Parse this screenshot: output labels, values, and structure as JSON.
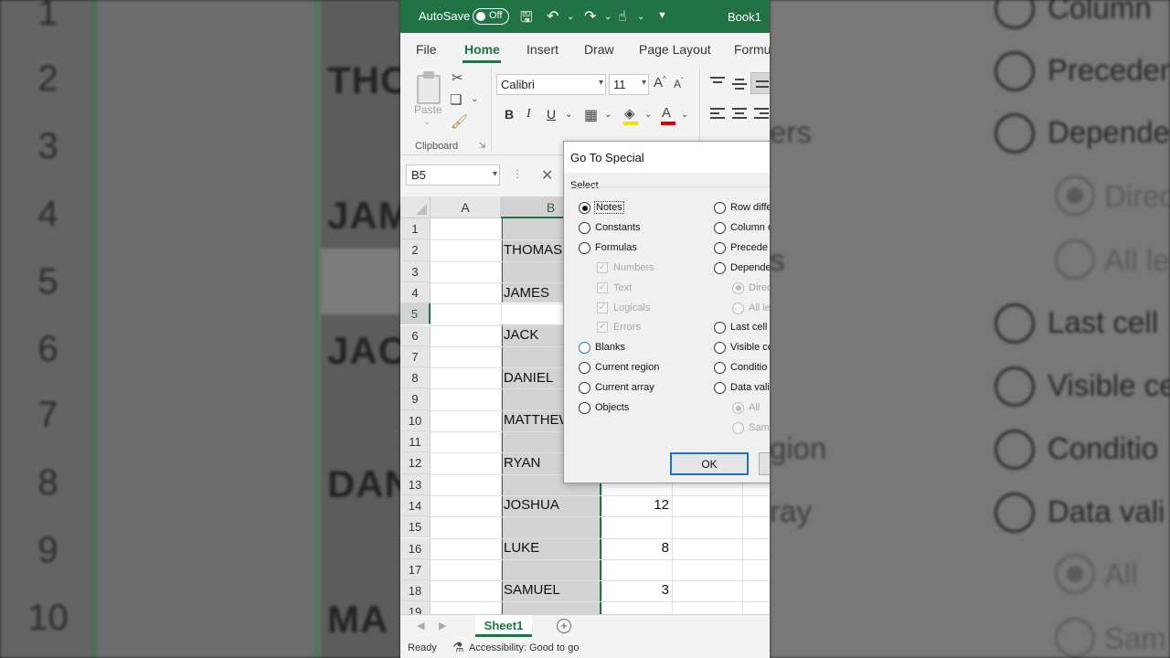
{
  "titlebar": {
    "autosave_label": "AutoSave",
    "autosave_state": "Off",
    "book_title": "Book1",
    "accent_color": "#217346"
  },
  "menu": {
    "tabs": [
      "File",
      "Home",
      "Insert",
      "Draw",
      "Page Layout",
      "Formu"
    ],
    "active_tab": "Home"
  },
  "ribbon": {
    "paste_label": "Paste",
    "clipboard_label": "Clipboard",
    "font_name": "Calibri",
    "font_size": "11",
    "bold": "B",
    "italic": "I",
    "underline": "U"
  },
  "formula_bar": {
    "name_box": "B5"
  },
  "grid": {
    "columns": [
      "A",
      "B"
    ],
    "selected_column": "B",
    "row_numbers": [
      "1",
      "2",
      "3",
      "4",
      "5",
      "6",
      "7",
      "8",
      "9",
      "10",
      "11",
      "12",
      "13",
      "14",
      "15",
      "16",
      "17",
      "18",
      "19"
    ],
    "cells_b": {
      "2": "THOMAS",
      "4": "JAMES",
      "6": "JACK",
      "8": "DANIEL",
      "10": "MATTHEW",
      "12": "RYAN",
      "14": "JOSHUA",
      "16": "LUKE",
      "18": "SAMUEL"
    },
    "cells_c": {
      "14": "12",
      "16": "8",
      "18": "3"
    }
  },
  "sheets": {
    "tabs": [
      "Sheet1"
    ]
  },
  "status": {
    "ready": "Ready",
    "accessibility": "Accessibility: Good to go"
  },
  "dialog": {
    "title": "Go To Special",
    "select_label": "Select",
    "left_options": [
      {
        "label": "Notes",
        "type": "radio",
        "checked": true,
        "disabled": false
      },
      {
        "label": "Constants",
        "type": "radio",
        "checked": false,
        "disabled": false
      },
      {
        "label": "Formulas",
        "type": "radio",
        "checked": false,
        "disabled": false
      },
      {
        "label": "Numbers",
        "type": "checkbox",
        "checked": true,
        "disabled": true
      },
      {
        "label": "Text",
        "type": "checkbox",
        "checked": true,
        "disabled": true
      },
      {
        "label": "Logicals",
        "type": "checkbox",
        "checked": true,
        "disabled": true
      },
      {
        "label": "Errors",
        "type": "checkbox",
        "checked": true,
        "disabled": true
      },
      {
        "label": "Blanks",
        "type": "radio",
        "checked": false,
        "disabled": false
      },
      {
        "label": "Current region",
        "type": "radio",
        "checked": false,
        "disabled": false
      },
      {
        "label": "Current array",
        "type": "radio",
        "checked": false,
        "disabled": false
      },
      {
        "label": "Objects",
        "type": "radio",
        "checked": false,
        "disabled": false
      }
    ],
    "right_options": [
      {
        "label": "Row diffe",
        "type": "radio",
        "checked": false,
        "disabled": false
      },
      {
        "label": "Column d",
        "type": "radio",
        "checked": false,
        "disabled": false
      },
      {
        "label": "Precede",
        "type": "radio",
        "checked": false,
        "disabled": false
      },
      {
        "label": "Depende",
        "type": "radio",
        "checked": false,
        "disabled": false
      },
      {
        "label": "Direc",
        "type": "radio",
        "checked": true,
        "disabled": true
      },
      {
        "label": "All le",
        "type": "radio",
        "checked": false,
        "disabled": true
      },
      {
        "label": "Last cell",
        "type": "radio",
        "checked": false,
        "disabled": false
      },
      {
        "label": "Visible ce",
        "type": "radio",
        "checked": false,
        "disabled": false
      },
      {
        "label": "Conditio",
        "type": "radio",
        "checked": false,
        "disabled": false
      },
      {
        "label": "Data vali",
        "type": "radio",
        "checked": false,
        "disabled": false
      },
      {
        "label": "All",
        "type": "radio",
        "checked": true,
        "disabled": true
      },
      {
        "label": "Same",
        "type": "radio",
        "checked": false,
        "disabled": true
      }
    ],
    "ok_label": "OK"
  },
  "background": {
    "left_row_numbers": [
      "1",
      "2",
      "3",
      "4",
      "5",
      "6",
      "7",
      "8",
      "9",
      "10"
    ],
    "left_names": [
      "THO",
      "JAM",
      "JAC",
      "DAN",
      "MA"
    ],
    "right_options": [
      "Column",
      "Preceden",
      "Depende",
      "Direc",
      "All le",
      "Last cell",
      "Visible ce",
      "Conditio",
      "Data vali",
      "All",
      "Sam"
    ],
    "right_fragments": [
      "ers",
      "s",
      "gion",
      "ray"
    ]
  }
}
